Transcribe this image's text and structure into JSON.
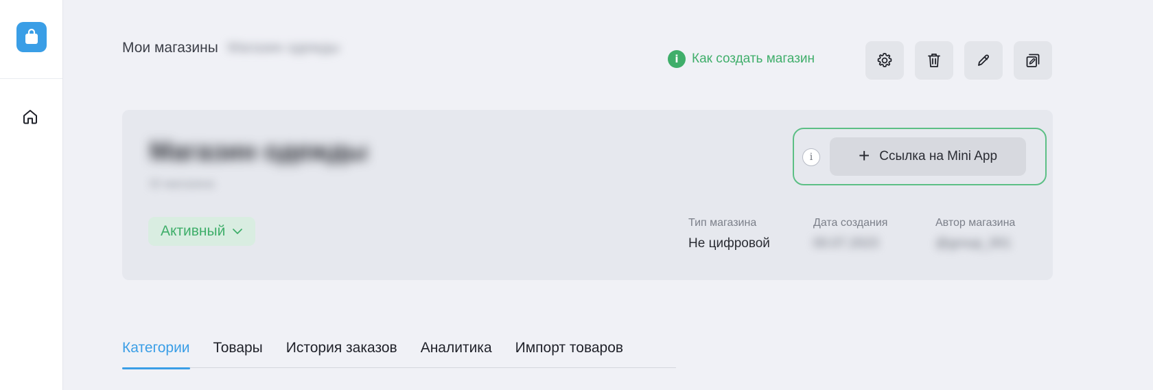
{
  "colors": {
    "accent": "#3a9ee6",
    "success": "#3fae6a",
    "background": "#f0f1f6"
  },
  "sidebar": {
    "logo_icon": "shopping-bag-icon",
    "nav": [
      {
        "icon": "home-icon"
      }
    ]
  },
  "header": {
    "breadcrumb_root": "Мои магазины",
    "breadcrumb_current": "Магазин одежды",
    "help_link": "Как создать магазин",
    "help_icon_glyph": "i",
    "tools": [
      {
        "icon": "gear-icon"
      },
      {
        "icon": "trash-icon"
      },
      {
        "icon": "pencil-icon"
      },
      {
        "icon": "copy-icon"
      }
    ]
  },
  "shop": {
    "name": "Магазин одежды",
    "subtitle": "ID магазина",
    "status": "Активный",
    "miniapp_info_glyph": "i",
    "miniapp_plus": "+",
    "miniapp_button": "Ссылка на Mini App",
    "meta": [
      {
        "label": "Тип магазина",
        "value": "Не цифровой"
      },
      {
        "label": "Дата создания",
        "value": "00.07.2023"
      },
      {
        "label": "Автор магазина",
        "value": "@group_001"
      }
    ]
  },
  "tabs": [
    {
      "label": "Категории",
      "active": true
    },
    {
      "label": "Товары",
      "active": false
    },
    {
      "label": "История заказов",
      "active": false
    },
    {
      "label": "Аналитика",
      "active": false
    },
    {
      "label": "Импорт товаров",
      "active": false
    }
  ]
}
